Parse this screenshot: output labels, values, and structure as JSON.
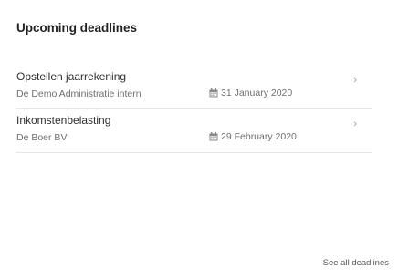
{
  "widget": {
    "title": "Upcoming deadlines",
    "see_all_label": "See all deadlines"
  },
  "deadlines": [
    {
      "title": "Opstellen jaarrekening",
      "client": "De Demo Administratie intern",
      "date": "31 January 2020",
      "icon": "calendar-icon"
    },
    {
      "title": "Inkomstenbelasting",
      "client": "De Boer BV",
      "date": "29 February 2020",
      "icon": "calendar-icon"
    }
  ],
  "icons": {
    "chevron": "›"
  }
}
